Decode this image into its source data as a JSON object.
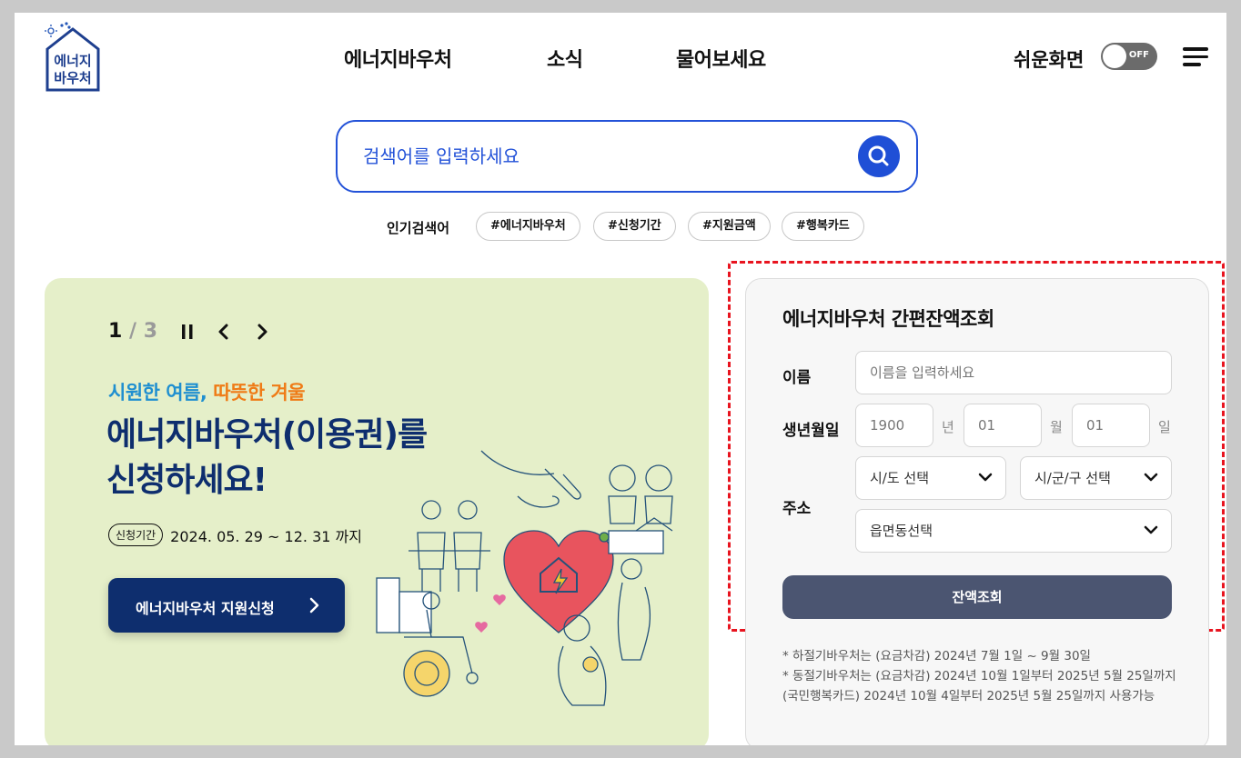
{
  "header": {
    "logo_text_line1": "에너지",
    "logo_text_line2": "바우처",
    "nav": [
      "에너지바우처",
      "소식",
      "물어보세요"
    ],
    "easy_view_label": "쉬운화면",
    "toggle_state": "OFF"
  },
  "search": {
    "placeholder": "검색어를 입력하세요",
    "popular_label": "인기검색어",
    "tags": [
      "#에너지바우처",
      "#신청기간",
      "#지원금액",
      "#행복카드"
    ]
  },
  "banner": {
    "current": "1",
    "separator": "/",
    "total": "3",
    "subtitle_part1": "시원한 여름,",
    "subtitle_part2": "따뜻한 겨울",
    "title_line1": "에너지바우처(이용권)를",
    "title_line2": "신청하세요!",
    "period_badge": "신청기간",
    "period_date": "2024. 05. 29 ~ 12. 31 까지",
    "apply_button": "에너지바우처 지원신청"
  },
  "balance": {
    "title": "에너지바우처 간편잔액조회",
    "name_label": "이름",
    "name_placeholder": "이름을 입력하세요",
    "birth_label": "생년월일",
    "year_value": "1900",
    "year_unit": "년",
    "month_value": "01",
    "month_unit": "월",
    "day_value": "01",
    "day_unit": "일",
    "address_label": "주소",
    "sido_select": "시/도 선택",
    "sigungu_select": "시/군/구 선택",
    "eupmyeondong_select": "읍면동선택",
    "submit_button": "잔액조회",
    "notes": [
      "* 하절기바우처는 (요금차감) 2024년 7월 1일 ~ 9월 30일",
      "* 동절기바우처는 (요금차감) 2024년 10월 1일부터 2025년 5월 25일까지 (국민행복카드) 2024년 10월 4일부터 2025년 5월 25일까지 사용가능"
    ]
  },
  "colors": {
    "brand_navy": "#0e2e6e",
    "search_blue": "#1f4fd6",
    "banner_bg": "#e5efc9",
    "highlight_red": "#e8141f",
    "submit_gray": "#4b5571"
  }
}
